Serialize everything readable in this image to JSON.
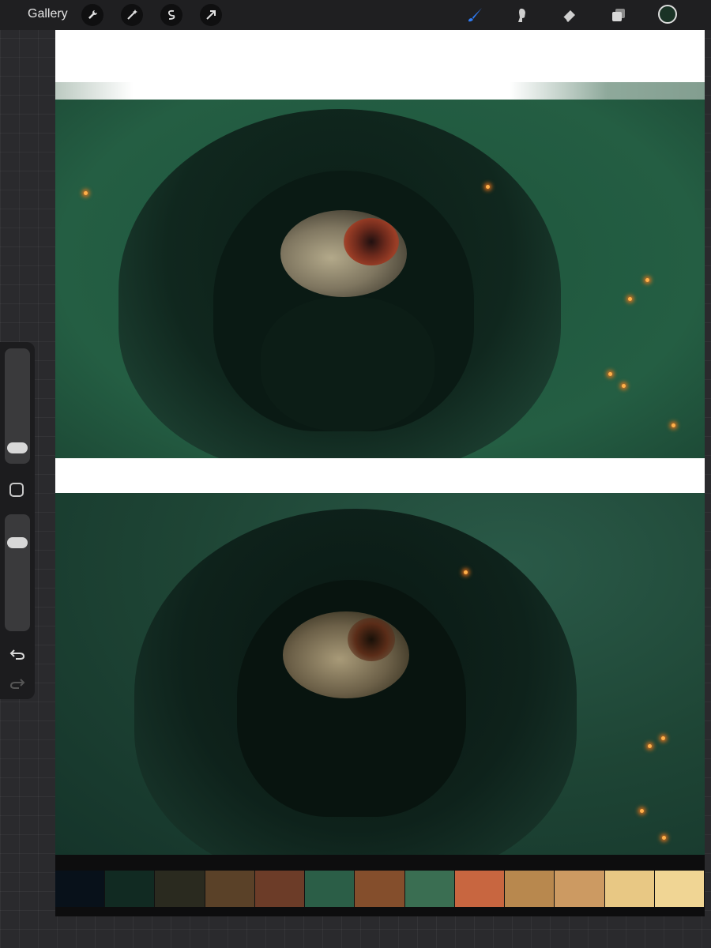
{
  "topbar": {
    "gallery_label": "Gallery",
    "left_tools": [
      "wrench-icon",
      "magic-wand-icon",
      "selection-icon",
      "transform-arrow-icon"
    ],
    "right_tools": [
      "brush-icon",
      "smudge-icon",
      "eraser-icon",
      "layers-icon"
    ],
    "active_tool": "brush-icon",
    "active_color": "#1a3326",
    "accent_color": "#2f7cf6"
  },
  "sidebar": {
    "brush_size_level": 0.12,
    "opacity_level": 0.75,
    "buttons": [
      "modify-square",
      "undo-icon",
      "redo-icon"
    ]
  },
  "palette": [
    "#08111a",
    "#112a22",
    "#2a2a1f",
    "#5a4128",
    "#6c3c28",
    "#2b5e47",
    "#844e2c",
    "#3a6e52",
    "#c86640",
    "#b8884e",
    "#cc9a62",
    "#e8c884",
    "#f0d594"
  ]
}
